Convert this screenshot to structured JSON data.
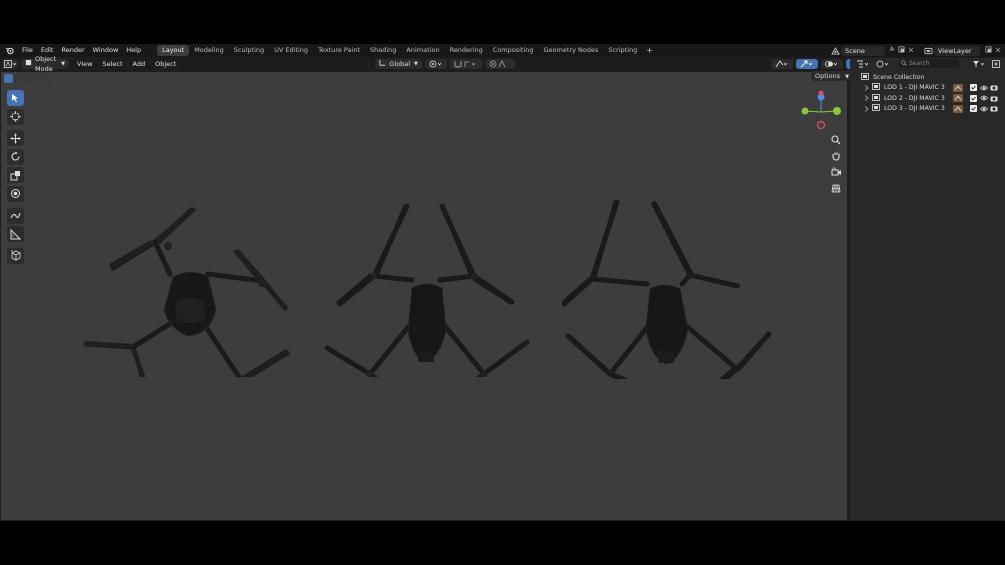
{
  "menu": {
    "items": [
      {
        "label": "File"
      },
      {
        "label": "Edit"
      },
      {
        "label": "Render"
      },
      {
        "label": "Window"
      },
      {
        "label": "Help"
      }
    ]
  },
  "workspaces": {
    "tabs": [
      {
        "label": "Layout",
        "active": true
      },
      {
        "label": "Modeling"
      },
      {
        "label": "Sculpting"
      },
      {
        "label": "UV Editing"
      },
      {
        "label": "Texture Paint"
      },
      {
        "label": "Shading"
      },
      {
        "label": "Animation"
      },
      {
        "label": "Rendering"
      },
      {
        "label": "Compositing"
      },
      {
        "label": "Geometry Nodes"
      },
      {
        "label": "Scripting"
      }
    ],
    "add_symbol": "+"
  },
  "scene": {
    "name": "Scene"
  },
  "view_layer": {
    "name": "ViewLayer"
  },
  "viewport_header": {
    "mode": "Object Mode",
    "menus": [
      "View",
      "Select",
      "Add",
      "Object"
    ],
    "transform_orientation": "Global",
    "options_label": "Options"
  },
  "toolbar": {
    "tools": [
      "select-box",
      "cursor",
      "move",
      "rotate",
      "scale",
      "transform",
      "annotate",
      "measure",
      "add-cube"
    ],
    "active": "select-box"
  },
  "gizmo": {
    "x_color": "#8cc63f",
    "y_color": "#4d8eeb",
    "z_color": "#e84a5f"
  },
  "outliner": {
    "search_placeholder": "Search",
    "collection_label": "Scene Collection",
    "rows": [
      {
        "label": "LOD 1 - DJI MAVIC 3"
      },
      {
        "label": "LOD 2 - DJI MAVIC 3"
      },
      {
        "label": "LOD 3 - DJI MAVIC 3"
      }
    ]
  },
  "colors": {
    "accent": "#4772b3",
    "viewport_bg": "#3d3d3d",
    "panel_bg": "#282828",
    "drone": "#1a1a1a"
  }
}
